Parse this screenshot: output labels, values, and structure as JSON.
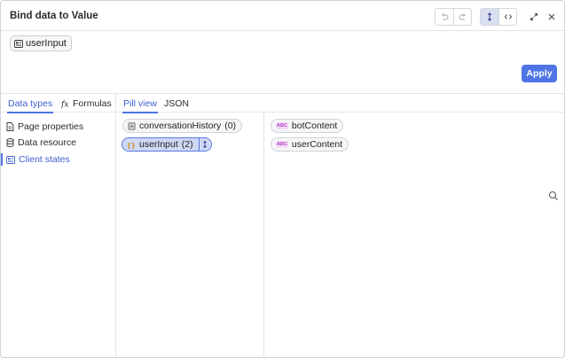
{
  "dialog": {
    "title": "Bind data to Value"
  },
  "expression": {
    "pill_label": "userInput"
  },
  "apply_label": "Apply",
  "left_tabs": [
    {
      "label": "Data types",
      "active": true
    },
    {
      "label": "Formulas",
      "active": false
    }
  ],
  "mid_tabs": [
    {
      "label": "Pill view",
      "active": true
    },
    {
      "label": "JSON",
      "active": false
    }
  ],
  "nav_items": [
    {
      "label": "Page properties",
      "icon": "page-icon",
      "active": false
    },
    {
      "label": "Data resource",
      "icon": "database-icon",
      "active": false
    },
    {
      "label": "Client states",
      "icon": "client-state-icon",
      "active": true
    }
  ],
  "variables": [
    {
      "label": "conversationHistory",
      "count": "(0)",
      "icon": "array-icon",
      "selected": false
    },
    {
      "label": "userInput",
      "count": "(2)",
      "icon": "object-icon",
      "selected": true
    }
  ],
  "fields": [
    {
      "label": "botContent",
      "type_tag": "ABC"
    },
    {
      "label": "userContent",
      "type_tag": "ABC"
    }
  ],
  "colors": {
    "accent": "#4e74e6",
    "accent_text": "#3e5fcf",
    "selected_pill": "#cfd8f5",
    "border": "#e4e6ea"
  }
}
